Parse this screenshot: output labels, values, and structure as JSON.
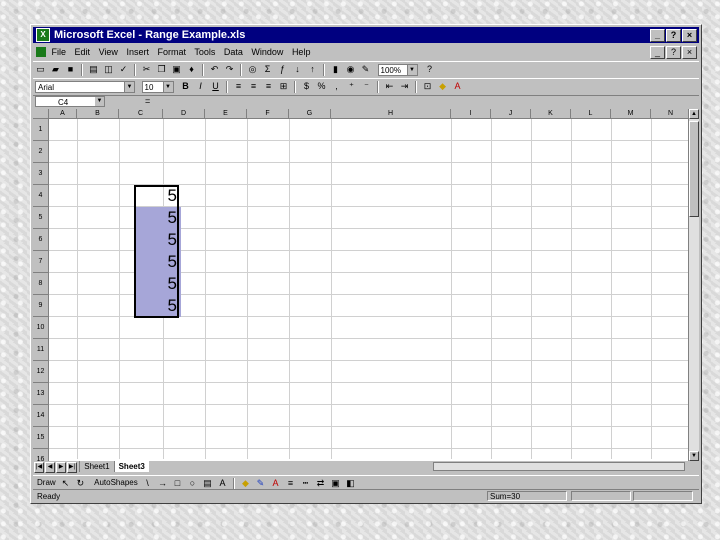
{
  "window": {
    "title": "Microsoft Excel - Range Example.xls",
    "controls": [
      "_",
      "?",
      "×"
    ],
    "doc_controls": [
      "_",
      "?",
      "×"
    ]
  },
  "menu": [
    "File",
    "Edit",
    "View",
    "Insert",
    "Format",
    "Tools",
    "Data",
    "Window",
    "Help"
  ],
  "toolbar": {
    "zoom": "100%",
    "font": "Arial",
    "font_size": "10"
  },
  "formula_bar": {
    "name_box": "C4",
    "fx": "=",
    "content": ""
  },
  "columns": [
    "A",
    "B",
    "C",
    "D",
    "E",
    "F",
    "G",
    "H",
    "I",
    "J",
    "K",
    "L",
    "M",
    "N",
    "O"
  ],
  "rows": [
    "1",
    "2",
    "3",
    "4",
    "5",
    "6",
    "7",
    "8",
    "9",
    "10",
    "11",
    "12",
    "13",
    "14",
    "15",
    "16"
  ],
  "cells": [
    {
      "ref": "C4",
      "value": "5",
      "selected": false
    },
    {
      "ref": "C5",
      "value": "5",
      "selected": true
    },
    {
      "ref": "C6",
      "value": "5",
      "selected": true
    },
    {
      "ref": "C7",
      "value": "5",
      "selected": true
    },
    {
      "ref": "C8",
      "value": "5",
      "selected": true
    },
    {
      "ref": "C9",
      "value": "5",
      "selected": true
    }
  ],
  "tabs": [
    {
      "label": "Sheet1",
      "active": false
    },
    {
      "label": "Sheet3",
      "active": true
    }
  ],
  "drawing_toolbar": {
    "draw_label": "Draw",
    "autoshapes_label": "AutoShapes"
  },
  "status": {
    "ready": "Ready",
    "sum": "Sum=30"
  },
  "colors": {
    "title_bar": "#000080",
    "selection": "#a6a6d8",
    "chrome": "#c0c0c0"
  }
}
